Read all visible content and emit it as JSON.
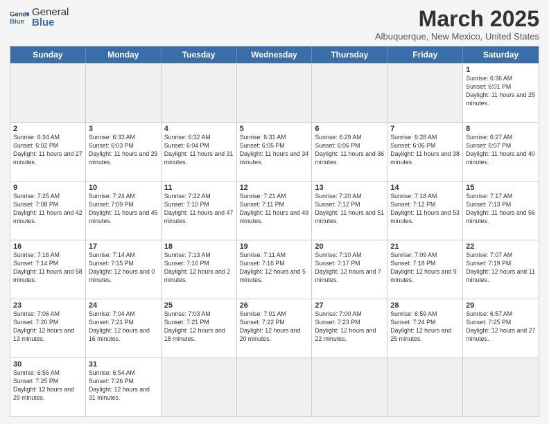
{
  "header": {
    "logo_general": "General",
    "logo_blue": "Blue",
    "month_title": "March 2025",
    "subtitle": "Albuquerque, New Mexico, United States"
  },
  "days_of_week": [
    "Sunday",
    "Monday",
    "Tuesday",
    "Wednesday",
    "Thursday",
    "Friday",
    "Saturday"
  ],
  "weeks": [
    [
      {
        "day": "",
        "empty": true
      },
      {
        "day": "",
        "empty": true
      },
      {
        "day": "",
        "empty": true
      },
      {
        "day": "",
        "empty": true
      },
      {
        "day": "",
        "empty": true
      },
      {
        "day": "",
        "empty": true
      },
      {
        "day": "1",
        "sunrise": "6:36 AM",
        "sunset": "6:01 PM",
        "daylight": "11 hours and 25 minutes."
      }
    ],
    [
      {
        "day": "2",
        "sunrise": "6:34 AM",
        "sunset": "6:02 PM",
        "daylight": "11 hours and 27 minutes."
      },
      {
        "day": "3",
        "sunrise": "6:33 AM",
        "sunset": "6:03 PM",
        "daylight": "11 hours and 29 minutes."
      },
      {
        "day": "4",
        "sunrise": "6:32 AM",
        "sunset": "6:04 PM",
        "daylight": "11 hours and 31 minutes."
      },
      {
        "day": "5",
        "sunrise": "6:31 AM",
        "sunset": "6:05 PM",
        "daylight": "11 hours and 34 minutes."
      },
      {
        "day": "6",
        "sunrise": "6:29 AM",
        "sunset": "6:06 PM",
        "daylight": "11 hours and 36 minutes."
      },
      {
        "day": "7",
        "sunrise": "6:28 AM",
        "sunset": "6:06 PM",
        "daylight": "11 hours and 38 minutes."
      },
      {
        "day": "8",
        "sunrise": "6:27 AM",
        "sunset": "6:07 PM",
        "daylight": "11 hours and 40 minutes."
      }
    ],
    [
      {
        "day": "9",
        "sunrise": "7:25 AM",
        "sunset": "7:08 PM",
        "daylight": "11 hours and 42 minutes."
      },
      {
        "day": "10",
        "sunrise": "7:24 AM",
        "sunset": "7:09 PM",
        "daylight": "11 hours and 45 minutes."
      },
      {
        "day": "11",
        "sunrise": "7:22 AM",
        "sunset": "7:10 PM",
        "daylight": "11 hours and 47 minutes."
      },
      {
        "day": "12",
        "sunrise": "7:21 AM",
        "sunset": "7:11 PM",
        "daylight": "11 hours and 49 minutes."
      },
      {
        "day": "13",
        "sunrise": "7:20 AM",
        "sunset": "7:12 PM",
        "daylight": "11 hours and 51 minutes."
      },
      {
        "day": "14",
        "sunrise": "7:18 AM",
        "sunset": "7:12 PM",
        "daylight": "11 hours and 53 minutes."
      },
      {
        "day": "15",
        "sunrise": "7:17 AM",
        "sunset": "7:13 PM",
        "daylight": "11 hours and 56 minutes."
      }
    ],
    [
      {
        "day": "16",
        "sunrise": "7:16 AM",
        "sunset": "7:14 PM",
        "daylight": "11 hours and 58 minutes."
      },
      {
        "day": "17",
        "sunrise": "7:14 AM",
        "sunset": "7:15 PM",
        "daylight": "12 hours and 0 minutes."
      },
      {
        "day": "18",
        "sunrise": "7:13 AM",
        "sunset": "7:16 PM",
        "daylight": "12 hours and 2 minutes."
      },
      {
        "day": "19",
        "sunrise": "7:11 AM",
        "sunset": "7:16 PM",
        "daylight": "12 hours and 5 minutes."
      },
      {
        "day": "20",
        "sunrise": "7:10 AM",
        "sunset": "7:17 PM",
        "daylight": "12 hours and 7 minutes."
      },
      {
        "day": "21",
        "sunrise": "7:09 AM",
        "sunset": "7:18 PM",
        "daylight": "12 hours and 9 minutes."
      },
      {
        "day": "22",
        "sunrise": "7:07 AM",
        "sunset": "7:19 PM",
        "daylight": "12 hours and 11 minutes."
      }
    ],
    [
      {
        "day": "23",
        "sunrise": "7:06 AM",
        "sunset": "7:20 PM",
        "daylight": "12 hours and 13 minutes."
      },
      {
        "day": "24",
        "sunrise": "7:04 AM",
        "sunset": "7:21 PM",
        "daylight": "12 hours and 16 minutes."
      },
      {
        "day": "25",
        "sunrise": "7:03 AM",
        "sunset": "7:21 PM",
        "daylight": "12 hours and 18 minutes."
      },
      {
        "day": "26",
        "sunrise": "7:01 AM",
        "sunset": "7:22 PM",
        "daylight": "12 hours and 20 minutes."
      },
      {
        "day": "27",
        "sunrise": "7:00 AM",
        "sunset": "7:23 PM",
        "daylight": "12 hours and 22 minutes."
      },
      {
        "day": "28",
        "sunrise": "6:59 AM",
        "sunset": "7:24 PM",
        "daylight": "12 hours and 25 minutes."
      },
      {
        "day": "29",
        "sunrise": "6:57 AM",
        "sunset": "7:25 PM",
        "daylight": "12 hours and 27 minutes."
      }
    ],
    [
      {
        "day": "30",
        "sunrise": "6:56 AM",
        "sunset": "7:25 PM",
        "daylight": "12 hours and 29 minutes."
      },
      {
        "day": "31",
        "sunrise": "6:54 AM",
        "sunset": "7:26 PM",
        "daylight": "12 hours and 31 minutes."
      },
      {
        "day": "",
        "empty": true
      },
      {
        "day": "",
        "empty": true
      },
      {
        "day": "",
        "empty": true
      },
      {
        "day": "",
        "empty": true
      },
      {
        "day": "",
        "empty": true
      }
    ]
  ]
}
